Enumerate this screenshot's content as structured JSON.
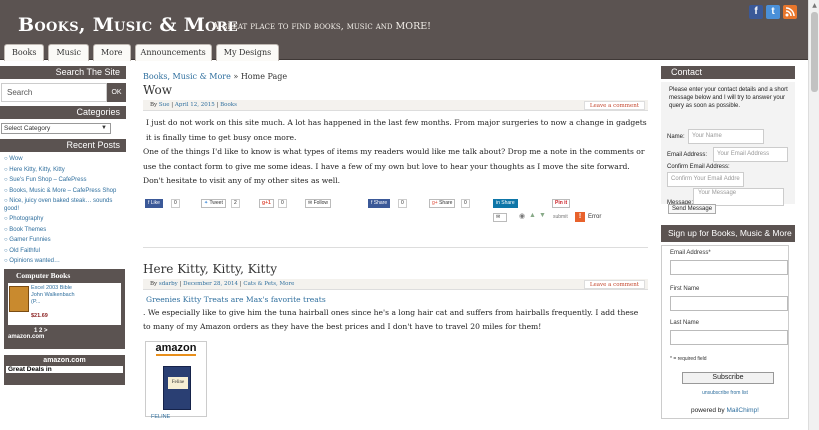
{
  "header": {
    "title": "Books, Music & More",
    "tagline": "A great place to find books, music and MORE!",
    "social": [
      "f",
      "t",
      "rss"
    ]
  },
  "nav": {
    "tabs": [
      "Books",
      "Music",
      "More",
      "Announcements",
      "My Designs"
    ]
  },
  "left_sidebar": {
    "search_heading": "Search The Site",
    "search_placeholder": "Search",
    "search_button": "OK",
    "categories_heading": "Categories",
    "category_select": "Select Category",
    "recent_heading": "Recent Posts",
    "recent_posts": [
      "Wow",
      "Here Kitty, Kitty, Kitty",
      "Sue's Fun Shop – CafePress",
      "Books, Music & More – CafePress Shop",
      "Nice, juicy oven baked steak… sounds good!",
      "Photography",
      "Book Themes",
      "Gamer Funnies",
      "Old Faithful",
      "Opinions wanted…"
    ],
    "computer_books": {
      "title": "Computer Books",
      "book_title": "Excel 2003 Bible John Walkenbach (P...",
      "price": "$21.69",
      "pager": "1 2 >",
      "brand": "amazon.com"
    },
    "amazon_box": {
      "brand": "amazon.com",
      "deal": "Great Deals in"
    }
  },
  "main": {
    "breadcrumb_link": "Books, Music & More",
    "breadcrumb_sep": "»",
    "breadcrumb_current": "Home Page",
    "post1": {
      "title": "Wow",
      "meta_by": "By",
      "meta_author": "Sue",
      "meta_date": "April 12, 2015",
      "meta_cat": "Books",
      "leave_comment": "Leave a comment",
      "paragraphs": [
        "I just do not work on this site much. A lot has happened in the last few months.  From major surgeries to now a change in gadgets it is finally time to get busy once more.",
        "One of the things I'd like to know is what types of items my readers would like me talk about?  Drop me a note in the comments or use the contact form to give me some ideas.  I have a few of my own but love to hear your thoughts as I move the site forward.",
        "Don't hesitate to visit any of my other sites as well."
      ],
      "share": {
        "like": "Like",
        "like_count": "0",
        "tweet": "Tweet",
        "tweet_count": "2",
        "gplus": "+1",
        "gplus_count": "0",
        "follow": "Follow",
        "fb_share": "Share",
        "fb_share_count": "0",
        "gshare": "Share",
        "gshare_count": "0",
        "in_share": "Share",
        "pinit": "Pin it",
        "submit": "submit",
        "error": "Error"
      }
    },
    "post2": {
      "title": "Here Kitty, Kitty, Kitty",
      "meta_by": "By",
      "meta_author": "sdarby",
      "meta_date": "December 28, 2014",
      "meta_cat": "Cats & Pets, More",
      "leave_comment": "Leave a comment",
      "link": "Greenies Kitty Treats are Max's favorite treats",
      "paragraph": ". We especially like to give him the tuna hairball ones since he's a long hair cat and suffers from hairballs frequently. I add these to many of my Amazon orders as they have the best prices and I don't have to travel 20 miles for them!",
      "amazon_logo": "amazon",
      "product_label": "Feline",
      "product_link": "FELINE"
    }
  },
  "right_sidebar": {
    "contact_heading": "Contact",
    "contact_intro": "Please enter your contact details and a short message below and I will try to answer your query as soon as possible.",
    "name_label": "Name:",
    "name_placeholder": "Your Name",
    "email_label": "Email Address:",
    "email_placeholder": "Your Email Address",
    "confirm_label": "Confirm Email Address:",
    "confirm_placeholder": "Confirm Your Email Addre",
    "message_label": "Message:",
    "message_placeholder": "Your Message",
    "send_button": "Send Message",
    "signup_heading": "Sign up for Books, Music & More",
    "mc_email_label": "Email Address*",
    "mc_first_label": "First Name",
    "mc_last_label": "Last Name",
    "mc_required": "* = required field",
    "mc_subscribe": "Subscribe",
    "mc_unsubscribe": "unsubscribe from list",
    "mc_powered_by": "powered by",
    "mc_mailchimp": "MailChimp!"
  },
  "colors": {
    "header_bg": "#5b5351",
    "link": "#2f6f9e",
    "comment_link": "#c2442b"
  }
}
